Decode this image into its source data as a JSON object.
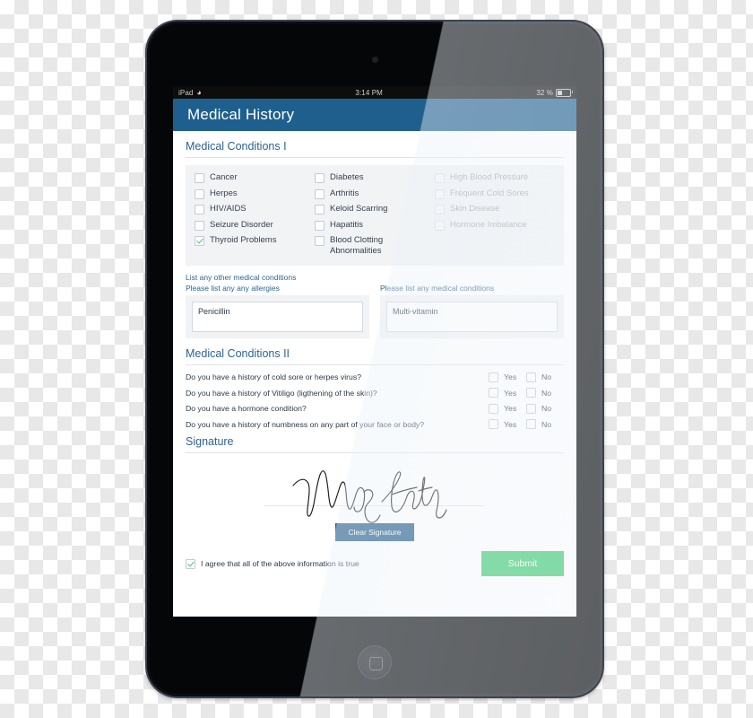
{
  "device": {
    "type": "ipad-tablet",
    "home_button": "home-button"
  },
  "status_bar": {
    "carrier": "iPad",
    "wifi_icon": "wifi-icon",
    "time": "3:14 PM",
    "battery_percent": "32 %",
    "battery_icon": "battery-icon"
  },
  "app_bar": {
    "title": "Medical History"
  },
  "sections": {
    "conditions_i": {
      "title": "Medical Conditions I",
      "columns": [
        {
          "dimmed": false,
          "items": [
            {
              "label": "Cancer",
              "checked": false
            },
            {
              "label": "Herpes",
              "checked": false
            },
            {
              "label": "HIV/AIDS",
              "checked": false
            },
            {
              "label": "Seizure Disorder",
              "checked": false
            },
            {
              "label": "Thyroid Problems",
              "checked": true
            }
          ]
        },
        {
          "dimmed": false,
          "items": [
            {
              "label": "Diabetes",
              "checked": false
            },
            {
              "label": "Arthritis",
              "checked": false
            },
            {
              "label": "Keloid Scarring",
              "checked": false
            },
            {
              "label": "Hapatitis",
              "checked": false
            },
            {
              "label": "Blood Clotting Abnormalities",
              "checked": false
            }
          ]
        },
        {
          "dimmed": true,
          "items": [
            {
              "label": "High Blood Pressure",
              "checked": false
            },
            {
              "label": "Frequent Cold Sores",
              "checked": false
            },
            {
              "label": "Skin Disease",
              "checked": false
            },
            {
              "label": "Hormone Imbalance",
              "checked": false
            }
          ]
        }
      ]
    },
    "other_conditions": {
      "heading": "List any other medical conditions",
      "fields": [
        {
          "label": "Please list any any allergies",
          "value": "Penicillin",
          "placeholder": ""
        },
        {
          "label": "Please list any medical conditions",
          "value": "Multi-vitamin",
          "placeholder": ""
        }
      ]
    },
    "conditions_ii": {
      "title": "Medical Conditions II",
      "yes_label": "Yes",
      "no_label": "No",
      "questions": [
        {
          "text": "Do you have a history of cold sore or herpes virus?",
          "yes": false,
          "no": false
        },
        {
          "text": "Do you have a history of Vitiligo (ligthening of the skin)?",
          "yes": false,
          "no": false
        },
        {
          "text": "Do you have a hormone condition?",
          "yes": false,
          "no": false
        },
        {
          "text": "Do you have a history of numbness on any part of your face or body?",
          "yes": false,
          "no": false
        }
      ]
    },
    "signature": {
      "title": "Signature",
      "signed_name": "Mary Smith",
      "clear_button": "Clear Signature",
      "agree_text": "I agree that all of the above information is true",
      "agree_checked": true,
      "submit_button": "Submit"
    }
  },
  "colors": {
    "app_bar": "#1e5f8e",
    "section_heading": "#2c6395",
    "panel_bg": "#f1f3f5",
    "check_green": "#3ecc71",
    "submit_green": "#3ecc71",
    "clear_blue": "#1f5a87",
    "body_text": "#2a3a4d"
  }
}
